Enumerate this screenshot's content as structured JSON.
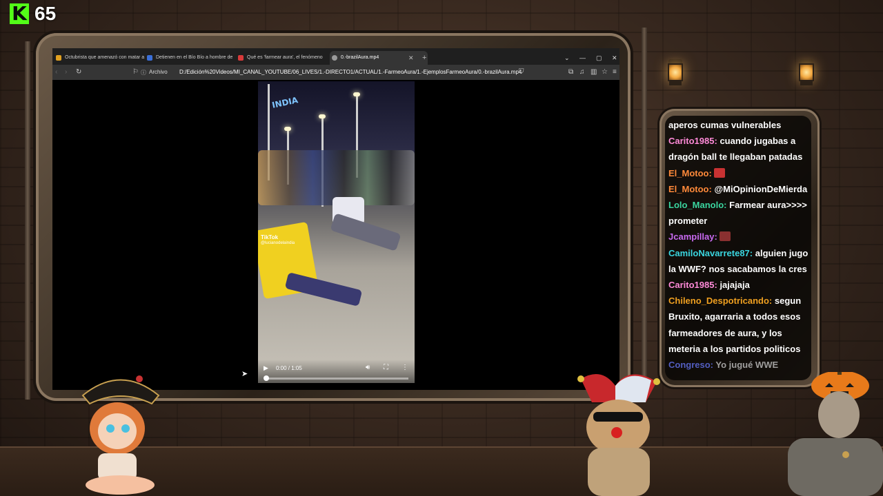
{
  "stream": {
    "viewer_count": "65",
    "brand_color": "#53fc18"
  },
  "browser": {
    "tabs": [
      {
        "title": "Octubrista que amenazó con matar a",
        "icon": "news-favicon",
        "color": "#e0a020",
        "active": false
      },
      {
        "title": "Detienen en el Bío Bío a hombre de",
        "icon": "news-favicon",
        "color": "#3a6fd8",
        "active": false
      },
      {
        "title": "Qué es 'farmear aura', el fenómeno",
        "icon": "news-favicon",
        "color": "#d83a3a",
        "active": false
      },
      {
        "title": "0.-brazilAura.mp4",
        "icon": "media-favicon",
        "color": "#9a9a9a",
        "active": true
      }
    ],
    "new_tab": "+",
    "address": {
      "label": "Archivo",
      "url": "D:/Edición%20Videos/MI_CANAL_YOUTUBE/06_LIVES/1.-DIRECTO1/ACTUAL/1.-FarmeoAura/1.-EjemplosFarmeoAura/0.-brazilAura.mp4"
    }
  },
  "video": {
    "overlay_badge": "INDIA",
    "watermark": "TikTok",
    "watermark_user": "@lucianodelaindia",
    "time": "0:00 / 1:05",
    "progress": 0.0
  },
  "chat": {
    "messages": [
      {
        "user": "",
        "text": "aperos cumas vulnerables",
        "color": "#ffffff"
      },
      {
        "user": "Carito1985",
        "text": "cuando jugabas a",
        "color": "#ff8ad8"
      },
      {
        "user": "",
        "text": "dragón ball te llegaban patadas",
        "color": "#ffffff"
      },
      {
        "user": "El_Motoo",
        "text": "",
        "color": "#ff8a3a",
        "emote": "#c83232"
      },
      {
        "user": "El_Motoo",
        "text": "@MiOpinionDeMierda",
        "color": "#ff8a3a"
      },
      {
        "user": "Lolo_Manolo",
        "text": "Farmear aura>>>>",
        "color": "#3ad6a0"
      },
      {
        "user": "",
        "text": "prometer",
        "color": "#ffffff"
      },
      {
        "user": "Jcampillay",
        "text": "",
        "color": "#c86af0",
        "emote": "#8a3030"
      },
      {
        "user": "CamiloNavarrete87",
        "text": "alguien jugo",
        "color": "#3ad6e0"
      },
      {
        "user": "",
        "text": "la WWF? nos sacabamos la cres",
        "color": "#ffffff"
      },
      {
        "user": "Carito1985",
        "text": "jajajaja",
        "color": "#ff8ad8"
      },
      {
        "user": "Chileno_Despotricando",
        "text": "segun",
        "color": "#f0a020"
      },
      {
        "user": "",
        "text": "Bruxito, agarraria a todos esos",
        "color": "#ffffff"
      },
      {
        "user": "",
        "text": "farmeadores de aura, y los",
        "color": "#ffffff"
      },
      {
        "user": "",
        "text": "meteria a los partidos politicos",
        "color": "#ffffff"
      },
      {
        "user": "Congreso",
        "text": "Yo jugué WWE",
        "color": "#6a7aff",
        "dim": true
      }
    ]
  }
}
